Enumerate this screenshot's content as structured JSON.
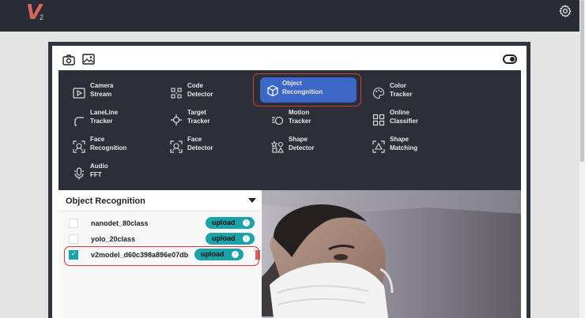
{
  "app": {
    "logo_text": "V",
    "logo_sub": "2"
  },
  "header": {
    "settings_icon": "gear-icon"
  },
  "toolbar": {
    "icons": [
      "camera-icon",
      "image-icon"
    ],
    "toggle": "toggle-switch"
  },
  "functions": [
    {
      "label": "Camera\nStream",
      "icon": "play-square-icon"
    },
    {
      "label": "Code\nDetector",
      "icon": "code-icon"
    },
    {
      "label": "Object\nRecongnition",
      "icon": "cube-icon",
      "active": true
    },
    {
      "label": "Color\nTracker",
      "icon": "palette-icon"
    },
    {
      "label": "LaneLine\nTracker",
      "icon": "lane-icon"
    },
    {
      "label": "Target\nTracker",
      "icon": "crosshair-icon"
    },
    {
      "label": "Motion\nTracker",
      "icon": "motion-icon"
    },
    {
      "label": "Online\nClassifier",
      "icon": "grid-icon"
    },
    {
      "label": "Face\nRecognition",
      "icon": "face-scan-icon"
    },
    {
      "label": "Face\nDetector",
      "icon": "face-detect-icon"
    },
    {
      "label": "Shape\nDetector",
      "icon": "shapes-icon"
    },
    {
      "label": "Shape\nMatching",
      "icon": "shape-match-icon"
    },
    {
      "label": "Audio\nFFT",
      "icon": "microphone-icon"
    }
  ],
  "recognition": {
    "title": "Object Recognition",
    "models": [
      {
        "name": "nanodet_80class",
        "checked": false,
        "button": "upload"
      },
      {
        "name": "yolo_20class",
        "checked": false,
        "button": "upload"
      },
      {
        "name": "v2model_d60c398a896e07db",
        "checked": true,
        "button": "upload"
      }
    ]
  },
  "colors": {
    "topbar": "#282d35",
    "accent": "#1aa3a8",
    "active": "#3d67c7",
    "highlight": "#d73a3a"
  }
}
